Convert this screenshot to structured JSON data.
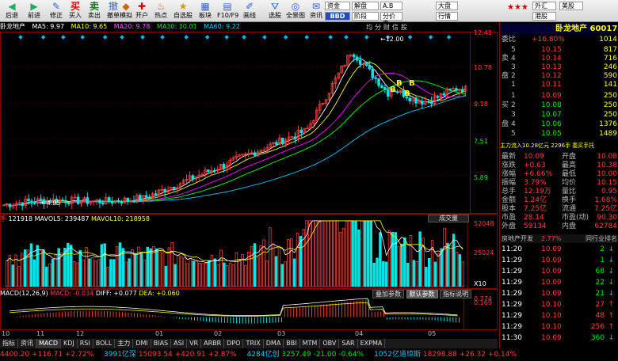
{
  "toolbar": {
    "buttons": [
      "后退",
      "前进",
      "修正",
      "买入",
      "卖出",
      "撤单",
      "模拟",
      "开户",
      "热点",
      "自选股",
      "板块",
      "F10/F9",
      "画线",
      "选股",
      "全景图",
      "资讯"
    ],
    "selects": [
      "资金",
      "BBD",
      "解盘",
      "阶段",
      "A.B",
      "分价表",
      "大盘",
      "行情",
      "外汇",
      "港股",
      "美股"
    ],
    "bbd_label": "BBD"
  },
  "ma_bar": {
    "title": "卧龙地产",
    "ma5": "MA5: 9.97",
    "ma10": "MA10: 9.65",
    "ma20": "MA20: 9.78",
    "ma30": "MA30: 10.01",
    "ma60": "MA60: 9.22"
  },
  "main_chart": {
    "corner_tabs": [
      "均",
      "分",
      "财",
      "信",
      "股"
    ],
    "high_label": "12.00",
    "low_label": "4.95",
    "b_markers": [
      "B",
      "B",
      "B",
      "B"
    ],
    "price_ticks": [
      "12.41",
      "10.78",
      "9.18",
      "7.51",
      "5.89"
    ]
  },
  "volume": {
    "label_hand": "手",
    "vol": "121918",
    "mavol5": "MAVOL5: 239487",
    "mavol10": "MAVOL10: 218958",
    "tick_top": "52048",
    "tick_mid": "25024",
    "tick_unit": "X10",
    "button": "成交量"
  },
  "macd": {
    "params": "MACD(12,26,9)",
    "macd": "MACD: -0.034",
    "diff": "DIFF: +0.077",
    "dea": "DEA: +0.060",
    "tick_top": "0.774",
    "tick_mid": "0.169",
    "buttons": [
      "叠加参数",
      "默认参数",
      "指标说明"
    ]
  },
  "time_axis": [
    "10",
    "11",
    "12",
    "01",
    "02",
    "03",
    "04",
    "05"
  ],
  "tabs": [
    "指标",
    "资讯",
    "MACD",
    "KDJ",
    "RSI",
    "BOLL",
    "主力",
    "DMI",
    "BIAS",
    "ASI",
    "VR",
    "ARBR",
    "DPO",
    "TRIX",
    "DMA",
    "BBI",
    "MTM",
    "OBV",
    "SAR",
    "EXPMA"
  ],
  "active_tab": "MACD",
  "status": {
    "sh_index": "4400.20",
    "sh_change": "+116.71",
    "sh_pct": "+2.72%",
    "sh_amount": "3991亿深",
    "sz_index": "15093.54",
    "sz_change": "+420.91",
    "sz_pct": "+2.87%",
    "sz_amount": "4284亿创",
    "cy_index": "3257.49",
    "cy_change": "-21.00",
    "cy_pct": "-0.64%",
    "cy_amount": "1052亿道琼斯",
    "dj_index": "18298.88",
    "dj_change": "+26.32",
    "dj_pct": "+0.14%"
  },
  "right_panel": {
    "stars": "★★★",
    "stock_name": "卧龙地产",
    "stock_code": "600173",
    "ratio_label": "委比",
    "ratio": "+16.80%",
    "ratio_vol": "1014",
    "asks": [
      {
        "level": "5",
        "price": "10.15",
        "vol": "817"
      },
      {
        "level": "4",
        "price": "10.14",
        "vol": "716"
      },
      {
        "level": "3",
        "price": "10.13",
        "vol": "246"
      },
      {
        "level": "2",
        "price": "10.12",
        "vol": "590"
      },
      {
        "level": "1",
        "price": "10.11",
        "vol": "141"
      }
    ],
    "bids": [
      {
        "level": "1",
        "price": "10.09",
        "vol": "250"
      },
      {
        "level": "2",
        "price": "10.08",
        "vol": "250"
      },
      {
        "level": "3",
        "price": "10.07",
        "vol": "250"
      },
      {
        "level": "4",
        "price": "10.06",
        "vol": "1376"
      },
      {
        "level": "5",
        "price": "10.05",
        "vol": "1489"
      }
    ],
    "ask_side_label": "卖盘",
    "bid_side_label": "买盘",
    "notice": "主力流入10.28亿元 2296手 委买手托",
    "stats": [
      {
        "k1": "最新",
        "v1": "10.09",
        "k2": "开盘",
        "v2": "10.08"
      },
      {
        "k1": "涨跌",
        "v1": "+0.63",
        "k2": "最高",
        "v2": "10.38"
      },
      {
        "k1": "涨幅",
        "v1": "+6.66%",
        "k2": "最低",
        "v2": "10.00"
      },
      {
        "k1": "振幅",
        "v1": "3.79%",
        "k2": "均价",
        "v2": "10.15"
      },
      {
        "k1": "总手",
        "v1": "12.19万",
        "k2": "量比",
        "v2": "0.95"
      },
      {
        "k1": "金额",
        "v1": "1.24亿",
        "k2": "换手",
        "v2": "1.68%"
      },
      {
        "k1": "股本",
        "v1": "7.25亿",
        "k2": "流通",
        "v2": "7.25亿"
      },
      {
        "k1": "市盈",
        "v1": "28.14",
        "k2": "市盈(动)",
        "v2": "90.30"
      },
      {
        "k1": "外盘",
        "v1": "59134",
        "k2": "内盘",
        "v2": "62784"
      }
    ],
    "sector_label": "房地产开发",
    "sector_pct": "2.77%",
    "sector_rank_label": "同行业排名",
    "ticks": [
      {
        "time": "11:20",
        "price": "10.09",
        "vol": "2",
        "dir": "↓"
      },
      {
        "time": "11:29",
        "price": "10.09",
        "vol": "1",
        "dir": "↓"
      },
      {
        "time": "11:29",
        "price": "10.09",
        "vol": "68",
        "dir": "↓"
      },
      {
        "time": "11:29",
        "price": "10.09",
        "vol": "22",
        "dir": "↓"
      },
      {
        "time": "11:29",
        "price": "10.09",
        "vol": "21",
        "dir": "↓"
      },
      {
        "time": "11:29",
        "price": "10.10",
        "vol": "27",
        "dir": "↑"
      },
      {
        "time": "11:29",
        "price": "10.10",
        "vol": "48",
        "dir": "↑"
      },
      {
        "time": "11:29",
        "price": "10.10",
        "vol": "256",
        "dir": "↑"
      },
      {
        "time": "11:30",
        "price": "10.09",
        "vol": "360",
        "dir": "↓"
      }
    ]
  },
  "colors": {
    "up": "#ff3c3c",
    "down": "#00e6e6",
    "ma5": "#ffffff",
    "ma10": "#ffff00",
    "ma20": "#ff00ff",
    "ma30": "#00ff00",
    "ma60": "#00c8ff"
  }
}
